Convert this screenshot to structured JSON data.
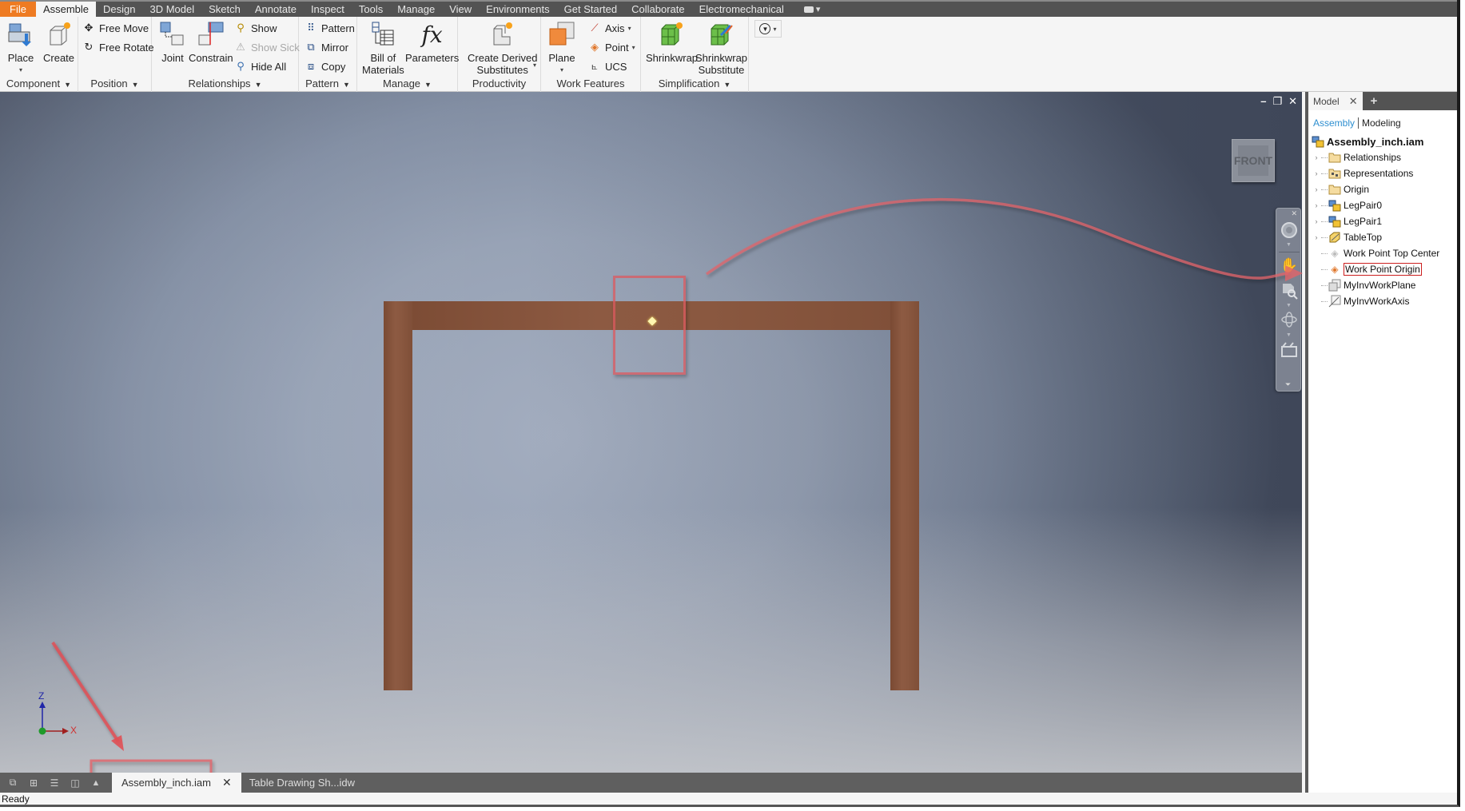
{
  "menubar": {
    "tabs": [
      "File",
      "Assemble",
      "Design",
      "3D Model",
      "Sketch",
      "Annotate",
      "Inspect",
      "Tools",
      "Manage",
      "View",
      "Environments",
      "Get Started",
      "Collaborate",
      "Electromechanical"
    ],
    "active_tab": "Assemble"
  },
  "ribbon": {
    "component": {
      "label": "Component",
      "place": "Place",
      "create": "Create"
    },
    "position": {
      "label": "Position",
      "free_move": "Free Move",
      "free_rotate": "Free Rotate"
    },
    "relationships": {
      "label": "Relationships",
      "joint": "Joint",
      "constrain": "Constrain",
      "show": "Show",
      "show_sick": "Show Sick",
      "hide_all": "Hide All"
    },
    "pattern": {
      "label": "Pattern",
      "pattern": "Pattern",
      "mirror": "Mirror",
      "copy": "Copy"
    },
    "manage": {
      "label": "Manage",
      "bom_line1": "Bill of",
      "bom_line2": "Materials",
      "parameters": "Parameters"
    },
    "productivity": {
      "label": "Productivity",
      "derived_line1": "Create Derived",
      "derived_line2": "Substitutes"
    },
    "work_features": {
      "label": "Work Features",
      "plane": "Plane",
      "axis": "Axis",
      "point": "Point",
      "ucs": "UCS"
    },
    "simplification": {
      "label": "Simplification",
      "shrinkwrap": "Shrinkwrap",
      "sws_line1": "Shrinkwrap",
      "sws_line2": "Substitute"
    }
  },
  "viewport": {
    "viewcube_face": "FRONT",
    "triad": {
      "z": "Z",
      "x": "X"
    },
    "colors": {
      "wood": "#8d5a42",
      "highlight": "#dc5a5f",
      "workpoint": "#fff6b0"
    }
  },
  "doc_tabs": {
    "tabs": [
      {
        "label": "Assembly_inch.iam",
        "active": true
      },
      {
        "label": "Table Drawing Sh...idw",
        "active": false
      }
    ]
  },
  "status": {
    "text": "Ready"
  },
  "browser": {
    "tab_label": "Model",
    "mode_assembly": "Assembly",
    "mode_modeling": "Modeling",
    "root": "Assembly_inch.iam",
    "nodes": [
      {
        "label": "Relationships",
        "icon": "folder-icon",
        "expandable": true
      },
      {
        "label": "Representations",
        "icon": "representations-icon",
        "expandable": true
      },
      {
        "label": "Origin",
        "icon": "folder-icon",
        "expandable": true
      },
      {
        "label": "LegPair0",
        "icon": "subassembly-icon",
        "expandable": true
      },
      {
        "label": "LegPair1",
        "icon": "subassembly-icon",
        "expandable": true
      },
      {
        "label": "TableTop",
        "icon": "part-icon",
        "expandable": true
      },
      {
        "label": "Work Point Top Center",
        "icon": "workpoint-icon",
        "expandable": false
      },
      {
        "label": "Work Point Origin",
        "icon": "workpoint-icon",
        "expandable": false,
        "selected": true
      },
      {
        "label": "MyInvWorkPlane",
        "icon": "workplane-icon",
        "expandable": false
      },
      {
        "label": "MyInvWorkAxis",
        "icon": "workaxis-icon",
        "expandable": false
      }
    ]
  }
}
